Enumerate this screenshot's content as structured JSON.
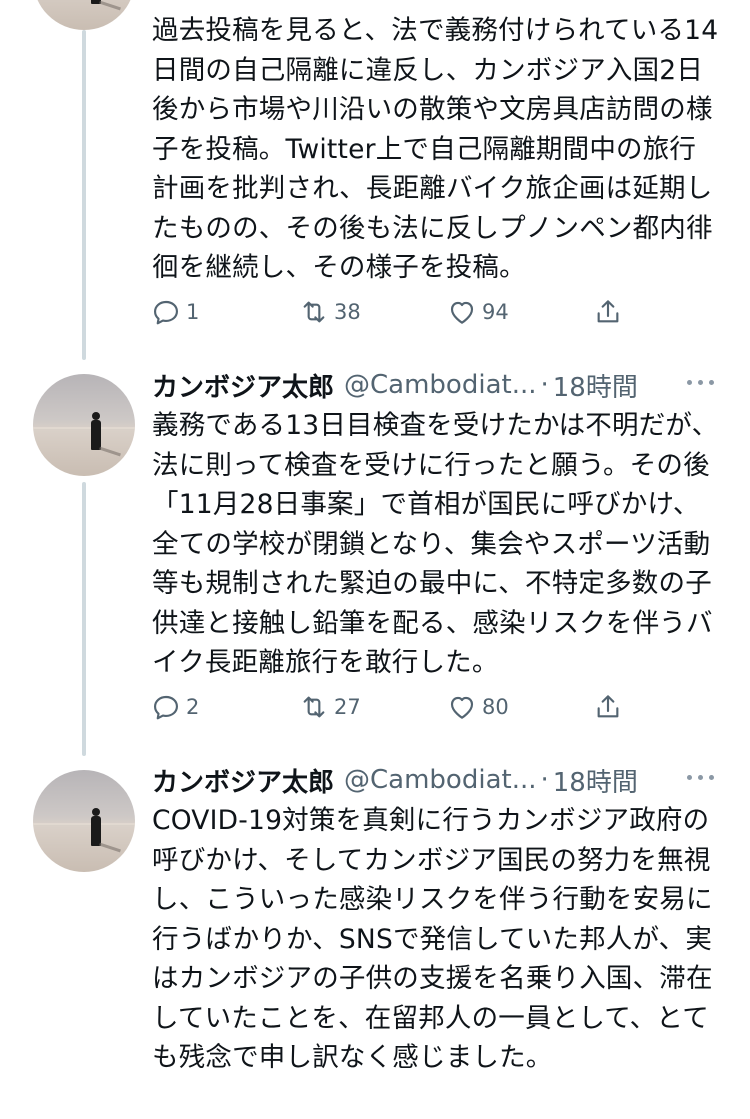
{
  "tweets": [
    {
      "text": "過去投稿を見ると、法で義務付けられている14日間の自己隔離に違反し、カンボジア入国2日後から市場や川沿いの散策や文房具店訪問の様子を投稿。Twitter上で自己隔離期間中の旅行計画を批判され、長距離バイク旅企画は延期したものの、その後も法に反しプノンペン都内徘徊を継続し、その様子を投稿。",
      "replies": "1",
      "retweets": "38",
      "likes": "94"
    },
    {
      "name": "カンボジア太郎",
      "handle": "@Cambodiat...",
      "separator": "·",
      "time": "18時間",
      "text": "義務である13日目検査を受けたかは不明だが、法に則って検査を受けに行ったと願う。その後「11月28日事案」で首相が国民に呼びかけ、全ての学校が閉鎖となり、集会やスポーツ活動等も規制された緊迫の最中に、不特定多数の子供達と接触し鉛筆を配る、感染リスクを伴うバイク長距離旅行を敢行した。",
      "replies": "2",
      "retweets": "27",
      "likes": "80"
    },
    {
      "name": "カンボジア太郎",
      "handle": "@Cambodiat...",
      "separator": "·",
      "time": "18時間",
      "text": "COVID-19対策を真剣に行うカンボジア政府の呼びかけ、そしてカンボジア国民の努力を無視し、こういった感染リスクを伴う行動を安易に行うばかりか、SNSで発信していた邦人が、実はカンボジアの子供の支援を名乗り入国、滞在していたことを、在留邦人の一員として、とても残念で申し訳なく感じました。"
    }
  ],
  "icons": {
    "reply": "reply-icon",
    "retweet": "retweet-icon",
    "like": "like-icon",
    "share": "share-icon",
    "more": "more-icon"
  },
  "colors": {
    "text": "#0f1419",
    "secondary": "#536471",
    "thread_line": "#cfd9de"
  }
}
